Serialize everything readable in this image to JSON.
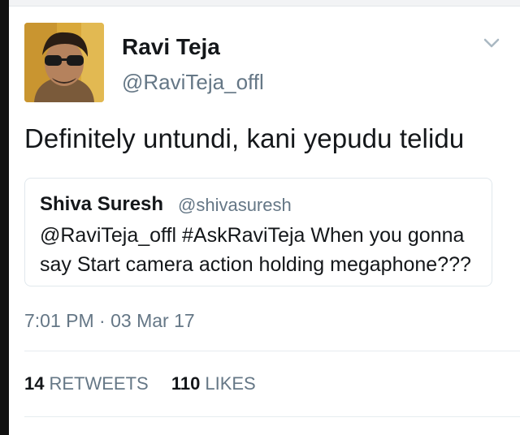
{
  "tweet": {
    "author_name": "Ravi Teja",
    "author_handle": "@RaviTeja_offl",
    "text": "Definitely untundi, kani yepudu telidu",
    "timestamp": "7:01 PM · 03 Mar 17",
    "retweets_count": "14",
    "retweets_label": "RETWEETS",
    "likes_count": "110",
    "likes_label": "LIKES",
    "menu_icon": "chevron-down-icon"
  },
  "quoted_tweet": {
    "author_name": "Shiva Suresh",
    "author_handle": "@shivasuresh",
    "text": "@RaviTeja_offl #AskRaviTeja When you gonna say Start camera action holding megaphone???"
  },
  "colors": {
    "text_primary": "#14171a",
    "text_secondary": "#657786",
    "border": "#e1e8ed"
  }
}
